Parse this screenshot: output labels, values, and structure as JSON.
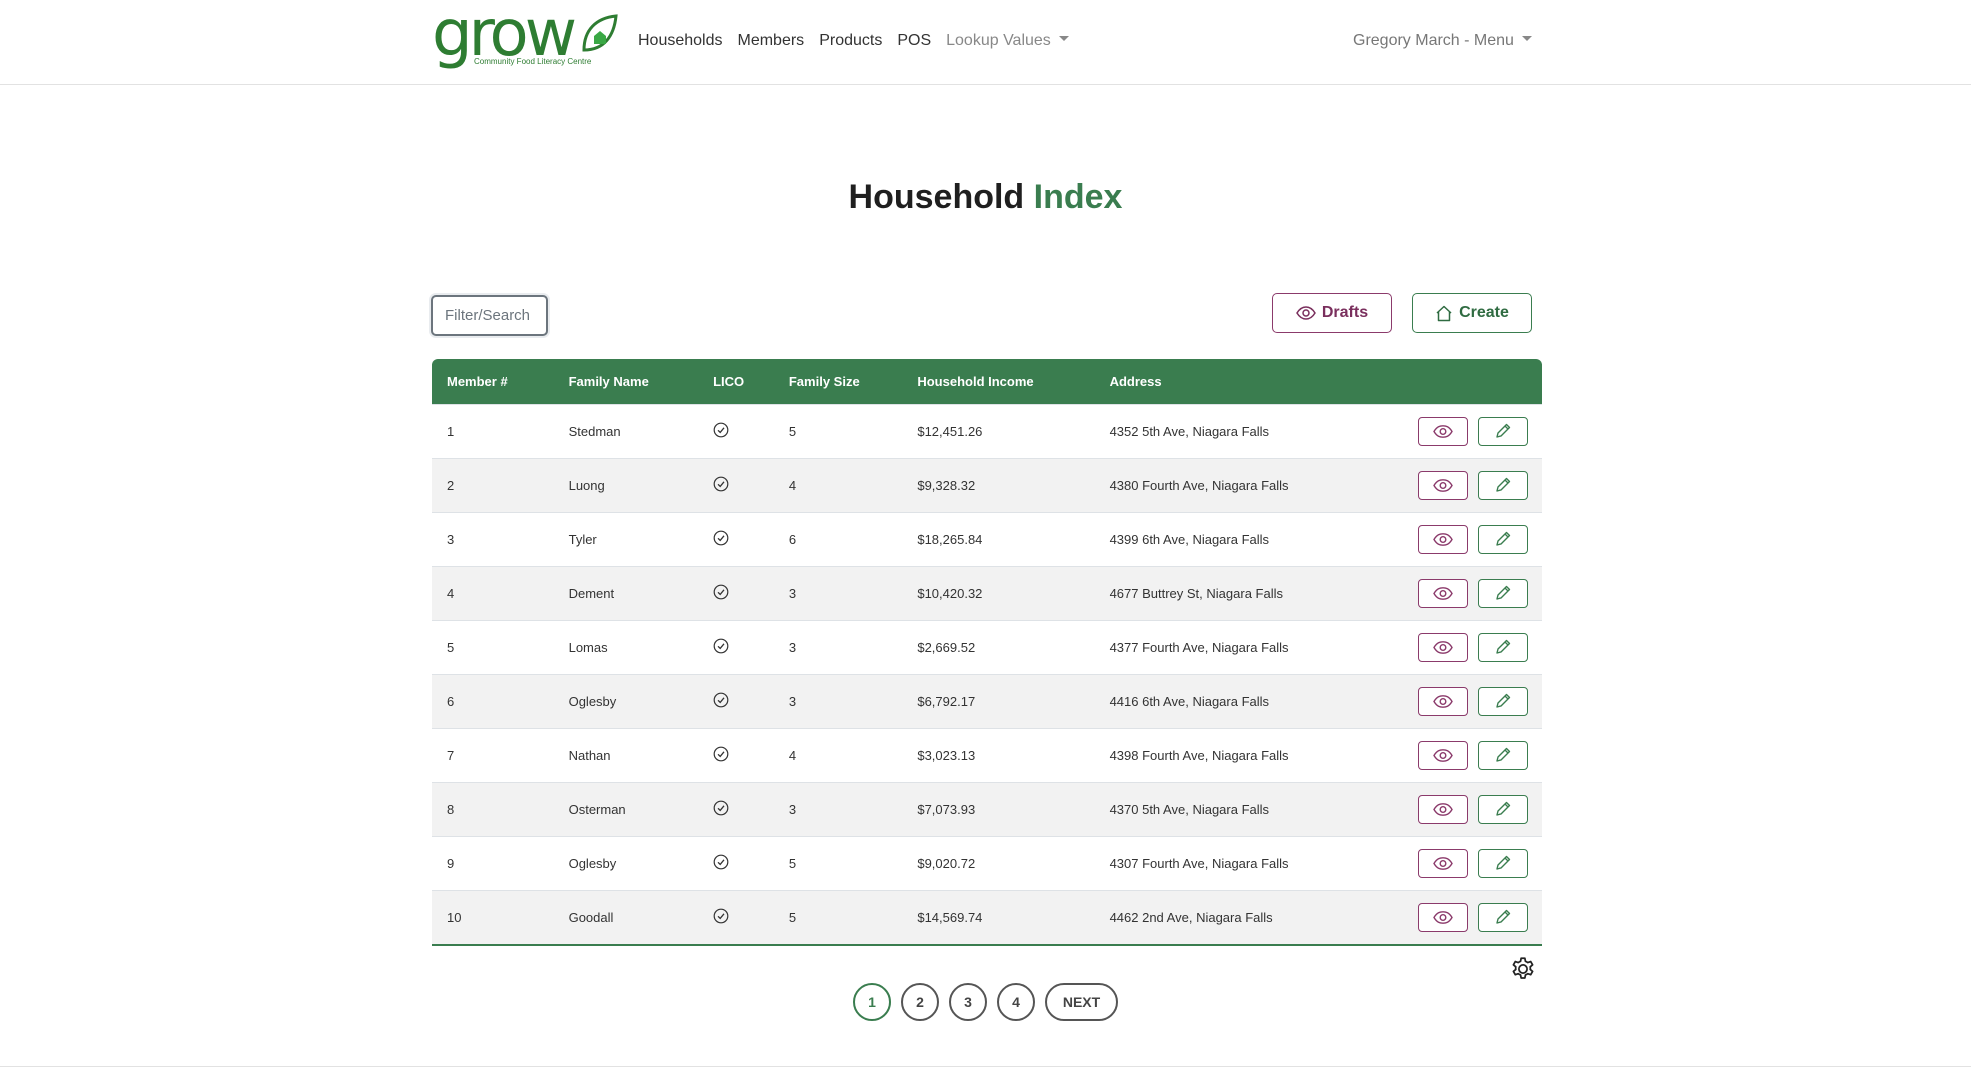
{
  "brand": {
    "word": "grow",
    "tagline": "Community Food Literacy Centre"
  },
  "nav": {
    "items": [
      {
        "label": "Households"
      },
      {
        "label": "Members"
      },
      {
        "label": "Products"
      },
      {
        "label": "POS"
      }
    ],
    "lookup_label": "Lookup Values",
    "user_menu": "Gregory March - Menu"
  },
  "page": {
    "title_main": "Household",
    "title_accent": "Index"
  },
  "toolbar": {
    "search_placeholder": "Filter/Search",
    "drafts_label": "Drafts",
    "create_label": "Create"
  },
  "table": {
    "headers": [
      "Member #",
      "Family Name",
      "LICO",
      "Family Size",
      "Household Income",
      "Address"
    ],
    "rows": [
      {
        "member": "1",
        "family": "Stedman",
        "lico": true,
        "size": "5",
        "income": "$12,451.26",
        "address": "4352 5th Ave, Niagara Falls"
      },
      {
        "member": "2",
        "family": "Luong",
        "lico": true,
        "size": "4",
        "income": "$9,328.32",
        "address": "4380 Fourth Ave, Niagara Falls"
      },
      {
        "member": "3",
        "family": "Tyler",
        "lico": true,
        "size": "6",
        "income": "$18,265.84",
        "address": "4399 6th Ave, Niagara Falls"
      },
      {
        "member": "4",
        "family": "Dement",
        "lico": true,
        "size": "3",
        "income": "$10,420.32",
        "address": "4677 Buttrey St, Niagara Falls"
      },
      {
        "member": "5",
        "family": "Lomas",
        "lico": true,
        "size": "3",
        "income": "$2,669.52",
        "address": "4377 Fourth Ave, Niagara Falls"
      },
      {
        "member": "6",
        "family": "Oglesby",
        "lico": true,
        "size": "3",
        "income": "$6,792.17",
        "address": "4416 6th Ave, Niagara Falls"
      },
      {
        "member": "7",
        "family": "Nathan",
        "lico": true,
        "size": "4",
        "income": "$3,023.13",
        "address": "4398 Fourth Ave, Niagara Falls"
      },
      {
        "member": "8",
        "family": "Osterman",
        "lico": true,
        "size": "3",
        "income": "$7,073.93",
        "address": "4370 5th Ave, Niagara Falls"
      },
      {
        "member": "9",
        "family": "Oglesby",
        "lico": true,
        "size": "5",
        "income": "$9,020.72",
        "address": "4307 Fourth Ave, Niagara Falls"
      },
      {
        "member": "10",
        "family": "Goodall",
        "lico": true,
        "size": "5",
        "income": "$14,569.74",
        "address": "4462 2nd Ave, Niagara Falls"
      }
    ]
  },
  "pagination": {
    "pages": [
      "1",
      "2",
      "3",
      "4"
    ],
    "current": "1",
    "next_label": "NEXT"
  },
  "icons": {
    "lico": "check-circle-icon",
    "view": "eye-icon",
    "edit": "pencil-icon",
    "settings": "gear-icon",
    "drafts": "eye-icon",
    "create": "house-icon"
  },
  "colors": {
    "primary_green": "#3a7d4f",
    "accent_purple": "#8b3a6b"
  }
}
